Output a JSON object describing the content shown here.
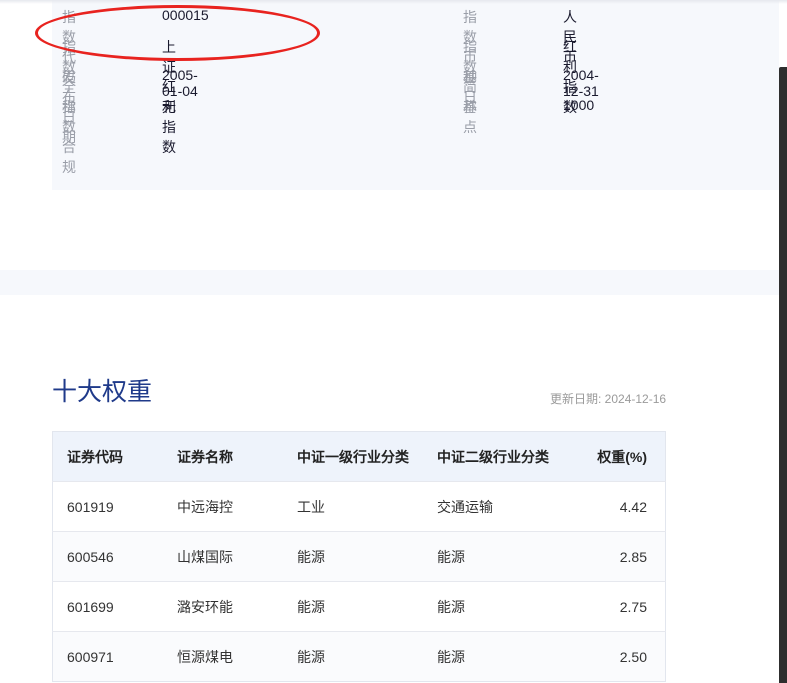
{
  "info": {
    "left": [
      {
        "label": "指数代码",
        "value": "000015"
      },
      {
        "label": "指数全称",
        "value": "上证红利指数"
      },
      {
        "label": "发布日期",
        "value": "2005-01-04"
      },
      {
        "label": "指数合规",
        "value": "无"
      }
    ],
    "right": [
      {
        "label": "指数币种",
        "value": "人民币"
      },
      {
        "label": "指数简称",
        "value": "红利指数"
      },
      {
        "label": "基日",
        "value": "2004-12-31"
      },
      {
        "label": "基点",
        "value": "1000"
      }
    ]
  },
  "annotation_color": "#e8231f",
  "weights": {
    "title": "十大权重",
    "update": "更新日期: 2024-12-16",
    "headers": [
      "证券代码",
      "证券名称",
      "中证一级行业分类",
      "中证二级行业分类",
      "权重(%)"
    ],
    "rows": [
      [
        "601919",
        "中远海控",
        "工业",
        "交通运输",
        "4.42"
      ],
      [
        "600546",
        "山煤国际",
        "能源",
        "能源",
        "2.85"
      ],
      [
        "601699",
        "潞安环能",
        "能源",
        "能源",
        "2.75"
      ],
      [
        "600971",
        "恒源煤电",
        "能源",
        "能源",
        "2.50"
      ]
    ]
  }
}
